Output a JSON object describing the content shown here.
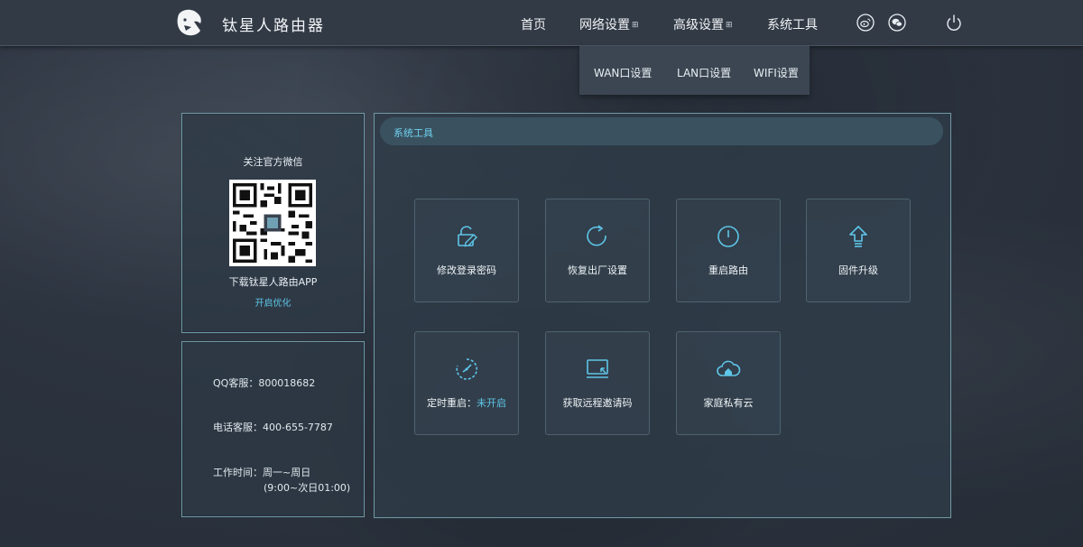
{
  "brand": "钛星人路由器",
  "nav": {
    "home": "首页",
    "network": "网络设置",
    "advanced": "高级设置",
    "tools": "系统工具",
    "menu_mark": "⊞"
  },
  "icons": {
    "logo": "ram-head-logo-icon",
    "weibo": "weibo-icon",
    "wechat": "wechat-icon",
    "power": "power-icon"
  },
  "dropdown": {
    "items": [
      "WAN口设置",
      "LAN口设置",
      "WIFI设置"
    ]
  },
  "sidebar": {
    "wechat_title": "关注官方微信",
    "app_text": "下载钛星人路由APP",
    "optimize_link": "开启优化",
    "qq": "QQ客服：800018682",
    "phone": "电话客服：400-655-7787",
    "hours_label": "工作时间：周一~周日",
    "hours_detail": "(9:00~次日01:00)"
  },
  "main": {
    "title": "系统工具",
    "tiles": [
      {
        "label": "修改登录密码",
        "icon": "lock-edit-icon"
      },
      {
        "label": "恢复出厂设置",
        "icon": "refresh-icon"
      },
      {
        "label": "重启路由",
        "icon": "power-icon"
      },
      {
        "label": "固件升级",
        "icon": "upload-arrow-icon"
      },
      {
        "label": "定时重启：",
        "status": "未开启",
        "icon": "clock-icon"
      },
      {
        "label": "获取远程邀请码",
        "icon": "remote-screen-icon"
      },
      {
        "label": "家庭私有云",
        "icon": "cloud-home-icon"
      }
    ]
  },
  "colors": {
    "accent": "#5ec6e8",
    "topbar": "#323a45",
    "panel_border": "#6f9aa6"
  }
}
